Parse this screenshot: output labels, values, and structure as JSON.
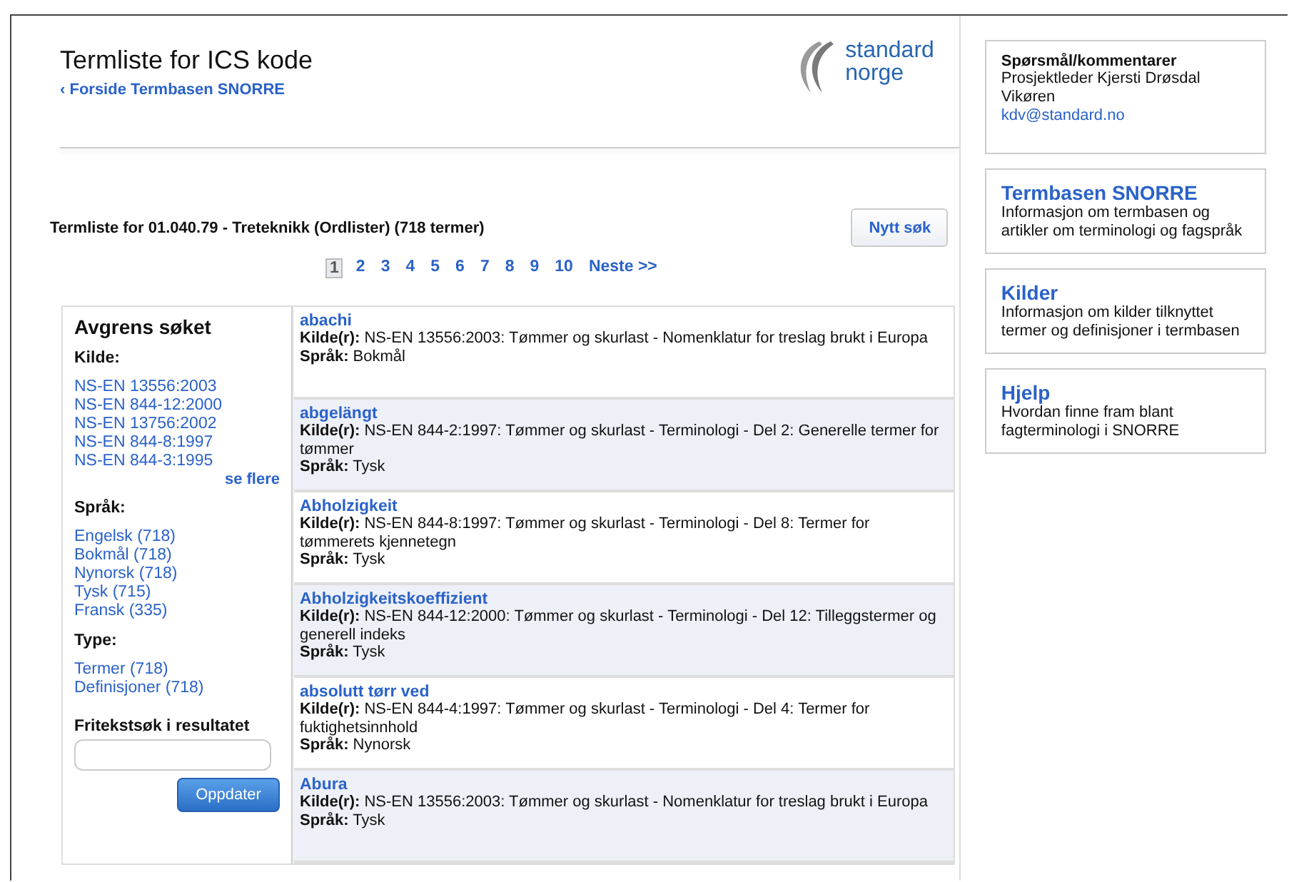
{
  "header": {
    "title": "Termliste for ICS kode",
    "back_link": "‹ Forside Termbasen SNORRE",
    "logo_text": [
      "standard",
      "norge"
    ]
  },
  "heading": "Termliste for 01.040.79 - Treteknikk (Ordlister) (718 termer)",
  "new_search_button": "Nytt søk",
  "pagination": {
    "pages": [
      {
        "label": "1",
        "selected": true
      },
      {
        "label": "2",
        "selected": false
      },
      {
        "label": "3",
        "selected": false
      },
      {
        "label": "4",
        "selected": false
      },
      {
        "label": "5",
        "selected": false
      },
      {
        "label": "6",
        "selected": false
      },
      {
        "label": "7",
        "selected": false
      },
      {
        "label": "8",
        "selected": false
      },
      {
        "label": "9",
        "selected": false
      },
      {
        "label": "10",
        "selected": false
      }
    ],
    "next": "Neste >>"
  },
  "filter": {
    "title": "Avgrens søket",
    "groups": [
      {
        "heading": "Kilde:",
        "items": [
          "NS-EN 13556:2003",
          "NS-EN 844-12:2000",
          "NS-EN 13756:2002",
          "NS-EN 844-8:1997",
          "NS-EN 844-3:1995"
        ],
        "more": "se flere"
      },
      {
        "heading": "Språk:",
        "items": [
          "Engelsk (718)",
          "Bokmål (718)",
          "Nynorsk (718)",
          "Tysk (715)",
          "Fransk (335)"
        ]
      },
      {
        "heading": "Type:",
        "items": [
          "Termer (718)",
          "Definisjoner (718)"
        ]
      }
    ],
    "search_label": "Fritekstsøk i resultatet",
    "update_button": "Oppdater"
  },
  "results": [
    {
      "term": "abachi",
      "source_label": "Kilde(r):",
      "source": "NS-EN 13556:2003: Tømmer og skurlast - Nomenklatur for treslag brukt i Europa",
      "language_label": "Språk:",
      "language": "Bokmål"
    },
    {
      "term": "abgelängt",
      "source_label": "Kilde(r):",
      "source": "NS-EN 844-2:1997: Tømmer og skurlast - Terminologi - Del 2: Generelle termer for tømmer",
      "language_label": "Språk:",
      "language": "Tysk"
    },
    {
      "term": "Abholzigkeit",
      "source_label": "Kilde(r):",
      "source": "NS-EN 844-8:1997: Tømmer og skurlast - Terminologi - Del 8: Termer for tømmerets kjennetegn",
      "language_label": "Språk:",
      "language": "Tysk"
    },
    {
      "term": "Abholzigkeitskoeffizient",
      "source_label": "Kilde(r):",
      "source": "NS-EN 844-12:2000: Tømmer og skurlast - Terminologi - Del 12: Tilleggstermer og generell indeks",
      "language_label": "Språk:",
      "language": "Tysk"
    },
    {
      "term": "absolutt tørr ved",
      "source_label": "Kilde(r):",
      "source": "NS-EN 844-4:1997: Tømmer og skurlast - Terminologi - Del 4: Termer for fuktighetsinnhold",
      "language_label": "Språk:",
      "language": "Nynorsk"
    },
    {
      "term": "Abura",
      "source_label": "Kilde(r):",
      "source": "NS-EN 13556:2003: Tømmer og skurlast - Nomenklatur for treslag brukt i Europa",
      "language_label": "Språk:",
      "language": "Tysk"
    }
  ],
  "sidebar": [
    {
      "kind": "contact",
      "title": "Spørsmål/kommentarer",
      "text": "Prosjektleder Kjersti Drøsdal Vikøren",
      "link": "kdv@standard.no"
    },
    {
      "kind": "link",
      "title": "Termbasen SNORRE",
      "text": "Informasjon om termbasen og artikler om terminologi og fagspråk"
    },
    {
      "kind": "link",
      "title": "Kilder",
      "text": "Informasjon om kilder tilknyttet termer og definisjoner i termbasen"
    },
    {
      "kind": "link",
      "title": "Hjelp",
      "text": "Hvordan finne fram blant fagterminologi i SNORRE"
    }
  ]
}
